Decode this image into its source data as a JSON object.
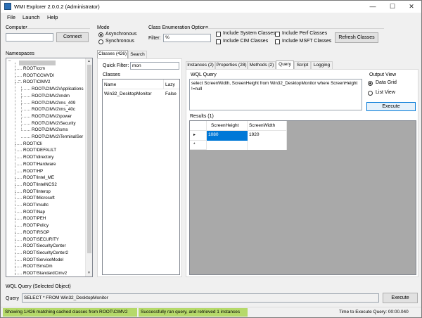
{
  "window": {
    "title": "WMI Explorer 2.0.0.2 (Administrator)",
    "controls": {
      "minimize": "—",
      "maximize": "☐",
      "close": "✕"
    }
  },
  "menu": {
    "file": "File",
    "launch": "Launch",
    "help": "Help"
  },
  "computer": {
    "label": "Computer",
    "value": "",
    "connect_label": "Connect"
  },
  "mode": {
    "label": "Mode",
    "asynchronous": "Asynchronous",
    "synchronous": "Synchronous",
    "selected": "Asynchronous"
  },
  "class_enum": {
    "label": "Class Enumeration Options",
    "filter_label": "Filter:",
    "filter_value": "%",
    "include_system": "Include System Classes",
    "include_cim": "Include CIM Classes",
    "include_perf": "Include Perf Classes",
    "include_msft": "Include MSFT Classes",
    "refresh_label": "Refresh Classes"
  },
  "namespaces": {
    "label": "Namespaces",
    "root_node": "",
    "items": [
      "ROOT\\ccm",
      "ROOT\\CCMVDI",
      "ROOT\\CIMV2",
      "ROOT\\CIMV2\\Applications",
      "ROOT\\CIMV2\\mdm",
      "ROOT\\CIMV2\\ms_409",
      "ROOT\\CIMV2\\ms_40c",
      "ROOT\\CIMV2\\power",
      "ROOT\\CIMV2\\Security",
      "ROOT\\CIMV2\\sms",
      "ROOT\\CIMV2\\TerminalSer",
      "ROOT\\Cli",
      "ROOT\\DEFAULT",
      "ROOT\\directory",
      "ROOT\\Hardware",
      "ROOT\\HP",
      "ROOT\\Intel_ME",
      "ROOT\\IntelNCS2",
      "ROOT\\Interop",
      "ROOT\\Microsoft",
      "ROOT\\msdtc",
      "ROOT\\Nap",
      "ROOT\\PEH",
      "ROOT\\Policy",
      "ROOT\\RSOP",
      "ROOT\\SECURITY",
      "ROOT\\SecurityCenter",
      "ROOT\\SecurityCenter2",
      "ROOT\\ServiceModel",
      "ROOT\\SmsDm",
      "ROOT\\StandardCimv2"
    ]
  },
  "left_tabs": {
    "classes": "Classes (426)",
    "search": "Search"
  },
  "quick_filter": {
    "label": "Quick Filter:",
    "value": "mon"
  },
  "classes": {
    "label": "Classes",
    "col_name": "Name",
    "col_lazy": "Lazy",
    "rows": [
      {
        "name": "Win32_DesktopMonitor",
        "lazy": "False"
      }
    ]
  },
  "right_tabs": {
    "instances": "Instances (2)",
    "properties": "Properties (28)",
    "methods": "Methods (2)",
    "query": "Query",
    "script": "Script",
    "logging": "Logging"
  },
  "wql": {
    "label": "WQL Query",
    "text": "select ScreenWidth, ScreenHeight from Win32_DesktopMonitor where ScreenHeight !=null"
  },
  "output_view": {
    "label": "Output View",
    "data_grid": "Data Grid",
    "list_view": "List View",
    "selected": "Data Grid",
    "execute_label": "Execute"
  },
  "results": {
    "label": "Results (1)",
    "col_height": "ScreenHeight",
    "col_width": "ScreenWidth",
    "row_height": "1080",
    "row_width": "1920",
    "current_row_marker": "▸",
    "new_row_marker": "*"
  },
  "bottom": {
    "section_label": "WQL Query (Selected Object)",
    "query_label": "Query",
    "query_value": "SELECT * FROM Win32_DesktopMonitor",
    "execute_label": "Execute"
  },
  "status": {
    "cached": "Showing 1/426 matching cached classes from ROOT\\CIMV2",
    "query_result": "Successfully ran query, and retrieved 1 instances",
    "time": "Time to Execute Query: 00:00.040"
  },
  "colors": {
    "status_green": "#b5d96a",
    "selection_blue": "#0078d7",
    "grid_bg": "#a9a9a9"
  }
}
